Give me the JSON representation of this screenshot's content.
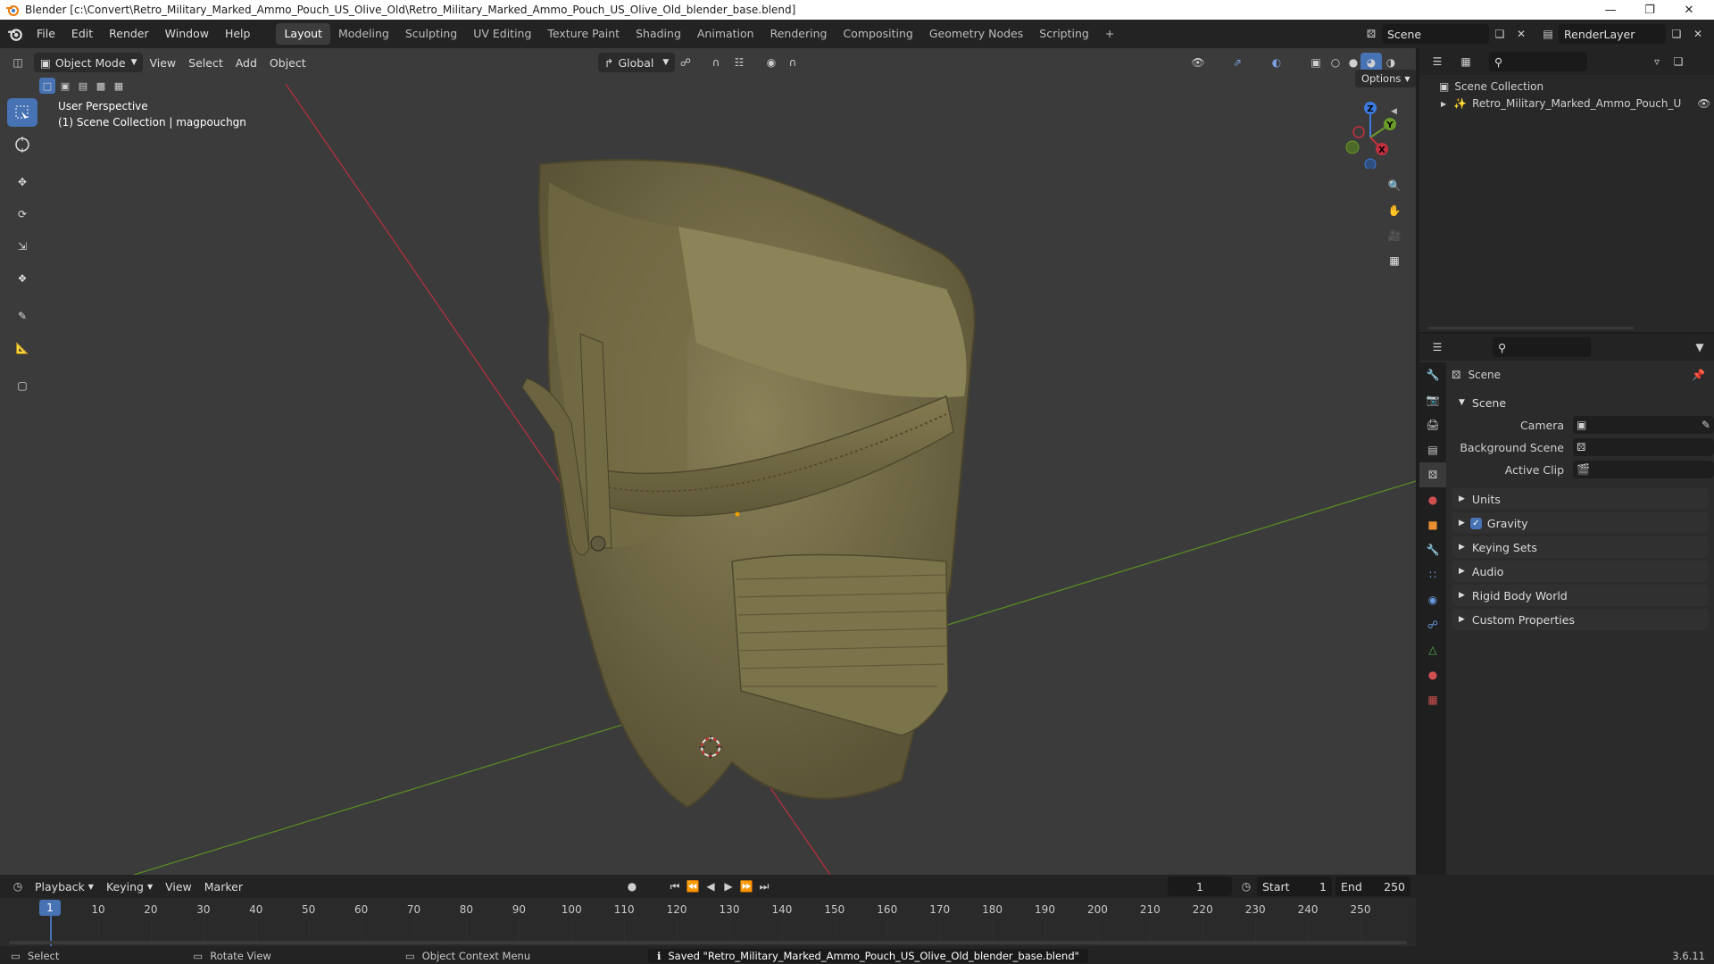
{
  "window": {
    "title": "Blender [c:\\Convert\\Retro_Military_Marked_Ammo_Pouch_US_Olive_Old\\Retro_Military_Marked_Ammo_Pouch_US_Olive_Old_blender_base.blend]"
  },
  "menus": [
    "File",
    "Edit",
    "Render",
    "Window",
    "Help"
  ],
  "workspace_tabs": [
    "Layout",
    "Modeling",
    "Sculpting",
    "UV Editing",
    "Texture Paint",
    "Shading",
    "Animation",
    "Rendering",
    "Compositing",
    "Geometry Nodes",
    "Scripting"
  ],
  "active_workspace": "Layout",
  "scene_name": "Scene",
  "view_layer": "RenderLayer",
  "viewport": {
    "mode": "Object Mode",
    "menus": [
      "View",
      "Select",
      "Add",
      "Object"
    ],
    "transform_orientation": "Global",
    "options_label": "Options",
    "overlay_title": "User Perspective",
    "overlay_subtitle": "(1) Scene Collection | magpouchgn",
    "gizmo_axes": {
      "x": "X",
      "y": "Y",
      "z": "Z"
    }
  },
  "outliner": {
    "root": "Scene Collection",
    "items": [
      {
        "label": "Retro_Military_Marked_Ammo_Pouch_U"
      }
    ]
  },
  "properties": {
    "header": "Scene",
    "panel_title": "Scene",
    "fields": [
      {
        "label": "Camera"
      },
      {
        "label": "Background Scene"
      },
      {
        "label": "Active Clip"
      }
    ],
    "sections": [
      "Units",
      "Gravity",
      "Keying Sets",
      "Audio",
      "Rigid Body World",
      "Custom Properties"
    ],
    "gravity_checked": true
  },
  "timeline": {
    "menus": [
      "Playback",
      "Keying",
      "View",
      "Marker"
    ],
    "current_frame": "1",
    "start_label": "Start",
    "start": "1",
    "end_label": "End",
    "end": "250",
    "ticks": [
      "1",
      "10",
      "20",
      "30",
      "40",
      "50",
      "60",
      "70",
      "80",
      "90",
      "100",
      "110",
      "120",
      "130",
      "140",
      "150",
      "160",
      "170",
      "180",
      "190",
      "200",
      "210",
      "220",
      "230",
      "240",
      "250"
    ]
  },
  "status": {
    "left": "Select",
    "middle": "Rotate View",
    "context": "Object Context Menu",
    "message": "Saved \"Retro_Military_Marked_Ammo_Pouch_US_Olive_Old_blender_base.blend\"",
    "version": "3.6.11"
  },
  "colors": {
    "accent": "#4772b3",
    "x_axis": "#c2303f",
    "y_axis": "#6a9a2a",
    "z_axis": "#3b7be0",
    "pouch": "#7a7148"
  }
}
